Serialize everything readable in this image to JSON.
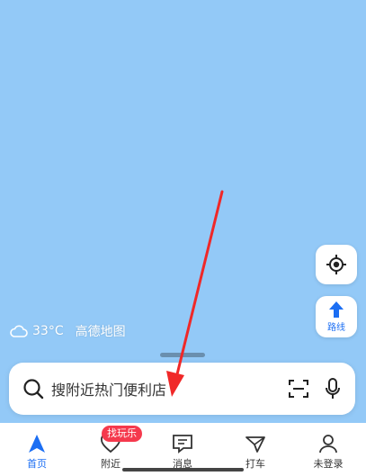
{
  "weather": {
    "icon": "cloud-icon",
    "temperature": "33°C",
    "provider": "高德地图"
  },
  "map_controls": {
    "locate_icon": "locate-icon",
    "route_label": "路线",
    "route_icon": "route-arrow-icon"
  },
  "search": {
    "placeholder": "搜附近热门便利店",
    "search_icon": "search-icon",
    "scan_icon": "scan-icon",
    "voice_icon": "microphone-icon"
  },
  "tabbar": {
    "tabs": [
      {
        "label": "首页",
        "icon": "navigation-arrow-icon",
        "active": true
      },
      {
        "label": "附近",
        "icon": "heart-location-icon",
        "active": false,
        "badge": "找玩乐"
      },
      {
        "label": "消息",
        "icon": "message-icon",
        "active": false
      },
      {
        "label": "打车",
        "icon": "taxi-icon",
        "active": false
      },
      {
        "label": "未登录",
        "icon": "user-icon",
        "active": false
      }
    ]
  },
  "colors": {
    "map_bg": "#93c9f7",
    "accent": "#1b6ef3",
    "badge": "#f5394d",
    "annotation_arrow": "#f02828"
  }
}
